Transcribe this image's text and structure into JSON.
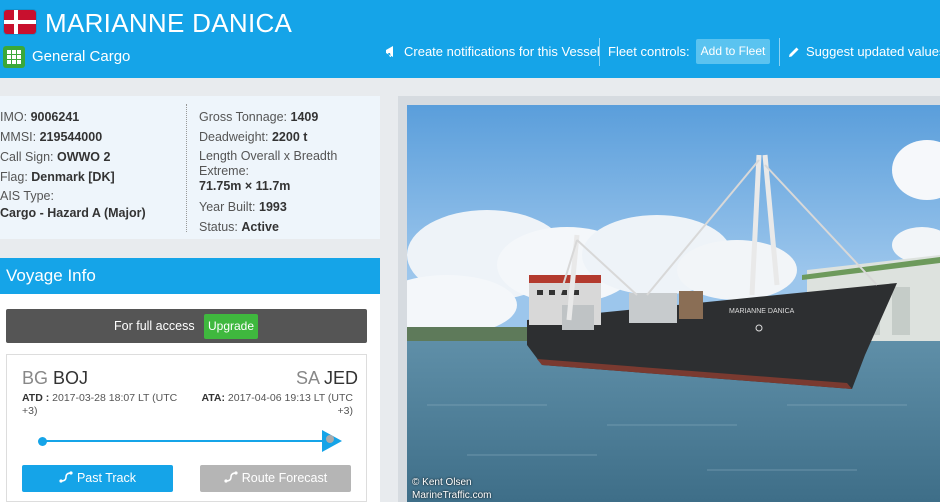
{
  "header": {
    "vessel_name": "MARIANNE DANICA",
    "vessel_type": "General Cargo",
    "flag_icon": "denmark-flag-icon",
    "notify_label": "Create notifications for this Vessel",
    "fleet_controls_label": "Fleet controls:",
    "add_to_fleet_label": "Add to Fleet",
    "suggest_label": "Suggest updated values"
  },
  "details": {
    "left": [
      {
        "label": "IMO:",
        "value": "9006241"
      },
      {
        "label": "MMSI:",
        "value": "219544000"
      },
      {
        "label": "Call Sign:",
        "value": "OWWO 2"
      },
      {
        "label": "Flag:",
        "value": "Denmark [DK]"
      },
      {
        "label": "AIS Type:",
        "value": "Cargo - Hazard A (Major)"
      }
    ],
    "right": [
      {
        "label": "Gross Tonnage:",
        "value": "1409"
      },
      {
        "label": "Deadweight:",
        "value": "2200 t"
      },
      {
        "label": "Length Overall x Breadth Extreme:",
        "value": "71.75m × 11.7m"
      },
      {
        "label": "Year Built:",
        "value": "1993"
      },
      {
        "label": "Status:",
        "value": "Active"
      }
    ]
  },
  "voyage": {
    "title": "Voyage Info",
    "access_text": "For full access",
    "upgrade_label": "Upgrade",
    "departure": {
      "country": "BG",
      "port": "BOJ",
      "label": "ATD :",
      "time": "2017-03-28 18:07 LT",
      "utc": "(UTC +3)"
    },
    "arrival": {
      "country": "SA",
      "port": "JED",
      "label": "ATA:",
      "time": "2017-04-06 19:13 LT",
      "utc": "(UTC +3)"
    },
    "past_track_label": "Past Track",
    "route_forecast_label": "Route Forecast"
  },
  "photo": {
    "credit_line1": "© Kent Olsen",
    "credit_line2": "MarineTraffic.com",
    "hull_text": "MARIANNE DANICA"
  },
  "colors": {
    "brand_blue": "#15a4e8",
    "upgrade_green": "#3fb83e",
    "type_icon_green": "#3aa839"
  }
}
